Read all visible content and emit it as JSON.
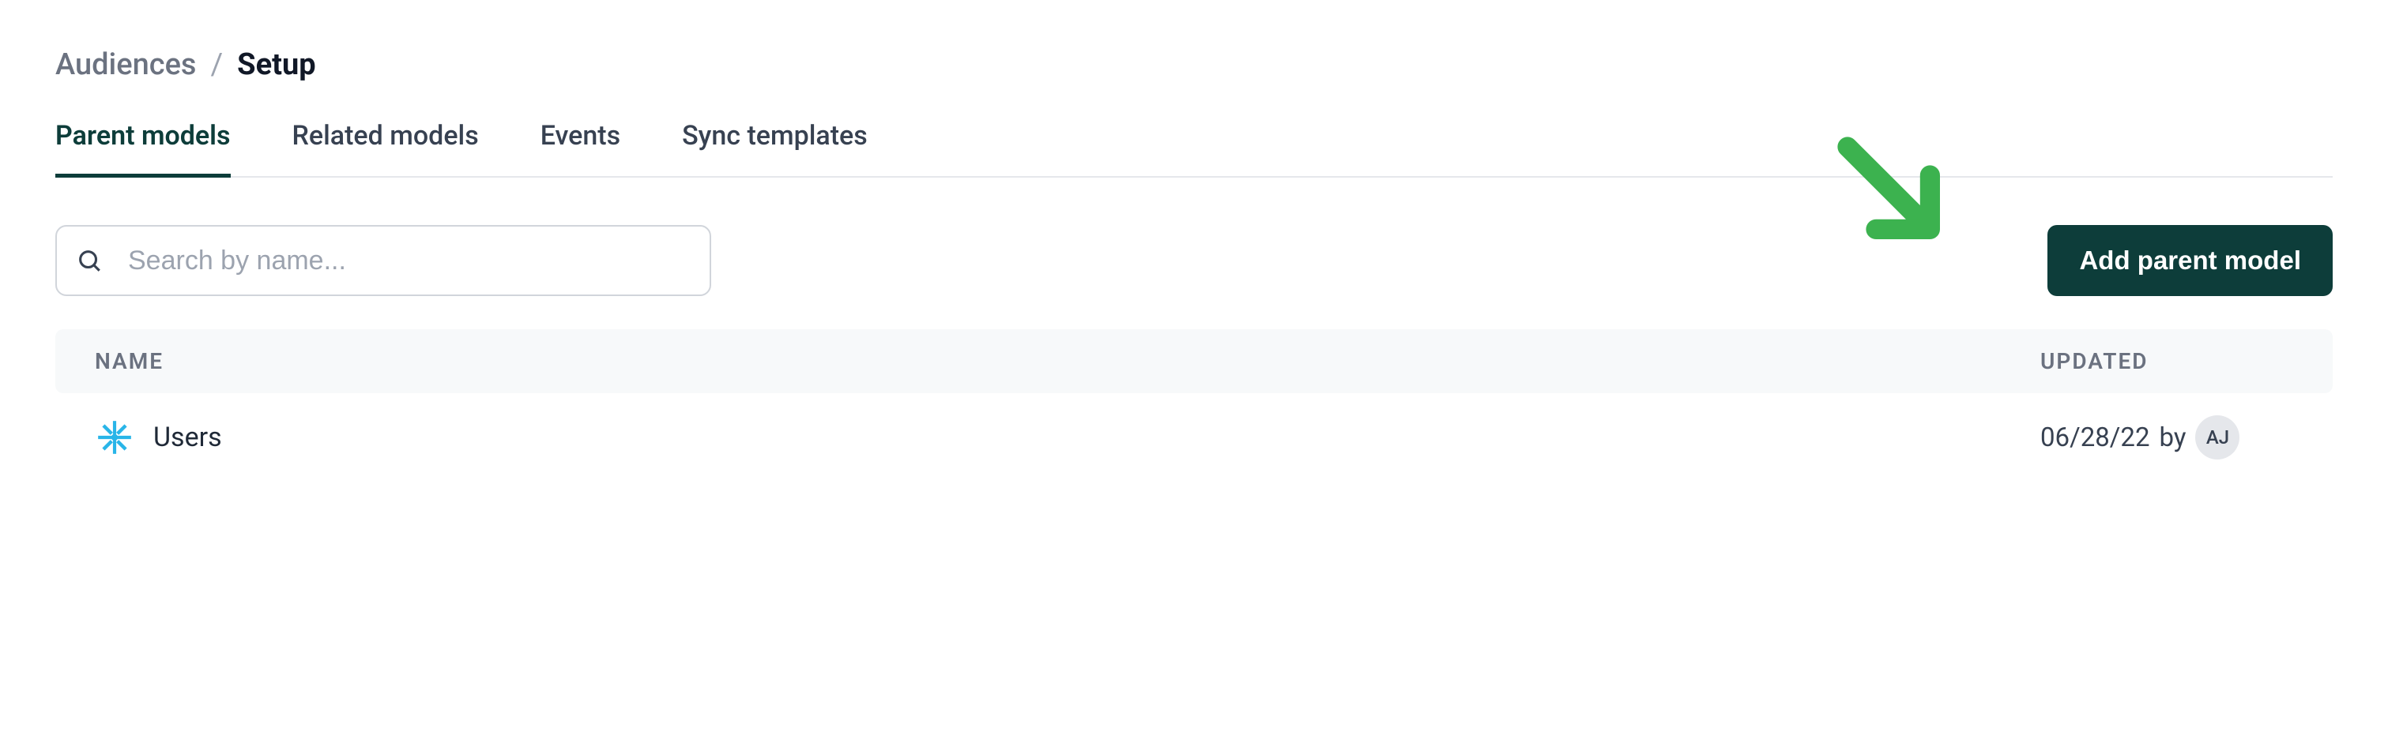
{
  "breadcrumb": {
    "parent": "Audiences",
    "separator": "/",
    "current": "Setup"
  },
  "tabs": [
    {
      "label": "Parent models",
      "active": true
    },
    {
      "label": "Related models",
      "active": false
    },
    {
      "label": "Events",
      "active": false
    },
    {
      "label": "Sync templates",
      "active": false
    }
  ],
  "search": {
    "placeholder": "Search by name..."
  },
  "buttons": {
    "add_parent_model": "Add parent model"
  },
  "table": {
    "headers": {
      "name": "NAME",
      "updated": "UPDATED"
    },
    "rows": [
      {
        "icon": "snowflake",
        "name": "Users",
        "updated_date": "06/28/22",
        "updated_by_label": "by",
        "updated_by_initials": "AJ"
      }
    ]
  }
}
